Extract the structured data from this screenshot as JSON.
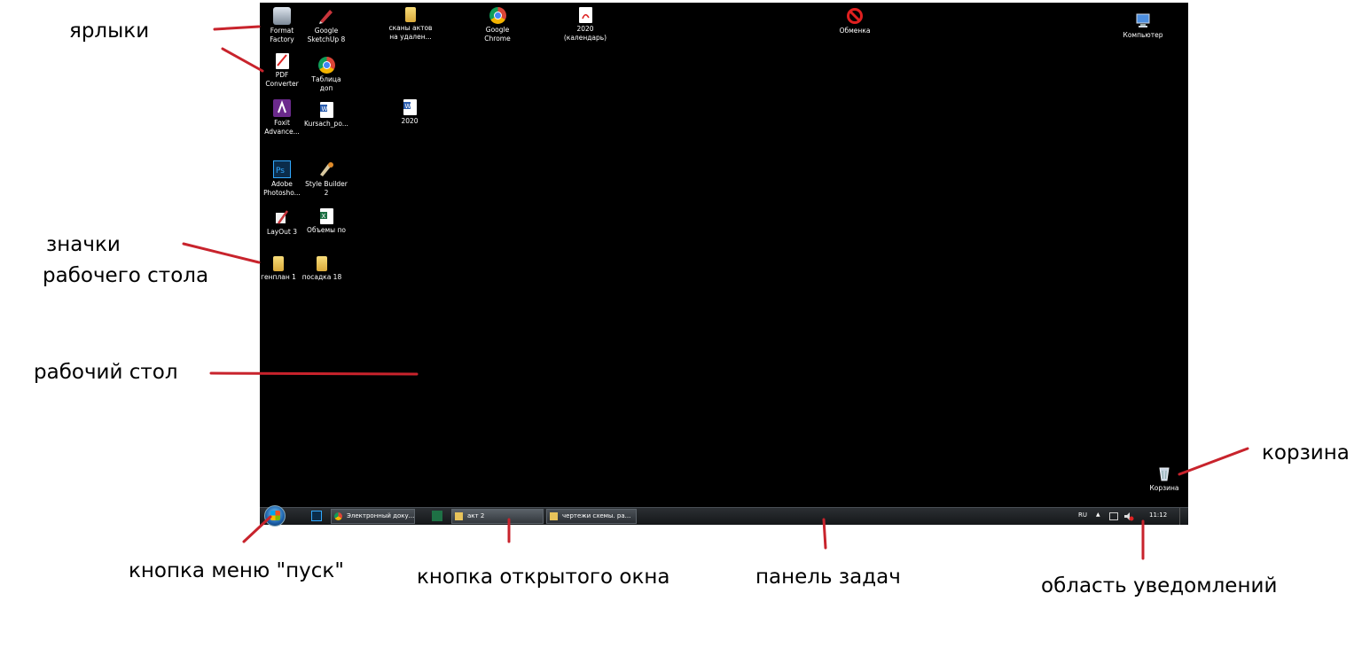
{
  "desktop": {
    "icons": [
      {
        "label": "Format\nFactory",
        "icon": "format-factory-icon"
      },
      {
        "label": "Google\nSketchUp 8",
        "icon": "sketchup-icon"
      },
      {
        "label": "сканы актов\nна удален...",
        "icon": "folder-icon"
      },
      {
        "label": "Google\nChrome",
        "icon": "chrome-icon"
      },
      {
        "label": "2020\n(календарь)",
        "icon": "pdf-icon"
      },
      {
        "label": "Обменка",
        "icon": "no-entry-icon"
      },
      {
        "label": "Компьютер",
        "icon": "computer-icon"
      },
      {
        "label": "PDF\nConverter",
        "icon": "pdf-converter-icon"
      },
      {
        "label": "Таблица доп",
        "icon": "chrome-icon"
      },
      {
        "label": "Foxit\nAdvance...",
        "icon": "foxit-icon"
      },
      {
        "label": "Kursach_po...",
        "icon": "word-icon"
      },
      {
        "label": "2020",
        "icon": "word-icon"
      },
      {
        "label": "Adobe\nPhotosho...",
        "icon": "photoshop-icon"
      },
      {
        "label": "Style Builder\n2",
        "icon": "style-builder-icon"
      },
      {
        "label": "LayOut 3",
        "icon": "layout-icon"
      },
      {
        "label": "Объемы по",
        "icon": "excel-icon"
      },
      {
        "label": "генплан 1",
        "icon": "folder-icon"
      },
      {
        "label": "посадка 18",
        "icon": "folder-icon"
      },
      {
        "label": "Корзина",
        "icon": "recycle-bin-icon"
      }
    ]
  },
  "taskbar": {
    "buttons": [
      {
        "label": "Электронный доку...",
        "icon": "chrome-icon"
      },
      {
        "label": "акт 2",
        "icon": "folder-icon"
      },
      {
        "label": "чертежи  схемы. ра...",
        "icon": "folder-icon"
      }
    ],
    "tray": {
      "language": "RU",
      "arrow": "▲",
      "clock": "11:12"
    }
  },
  "annotations": {
    "shortcuts": "ярлыки",
    "desktop_icons_line1": "значки",
    "desktop_icons_line2": "рабочего стола",
    "desktop": "рабочий стол",
    "recycle_bin": "корзина",
    "start_button": "кнопка меню \"пуск\"",
    "open_window_button": "кнопка открытого окна",
    "taskbar": "панель задач",
    "notification_area": "область уведомлений"
  },
  "colors": {
    "annotation_line": "#c8232c",
    "desktop_bg": "#000000"
  }
}
